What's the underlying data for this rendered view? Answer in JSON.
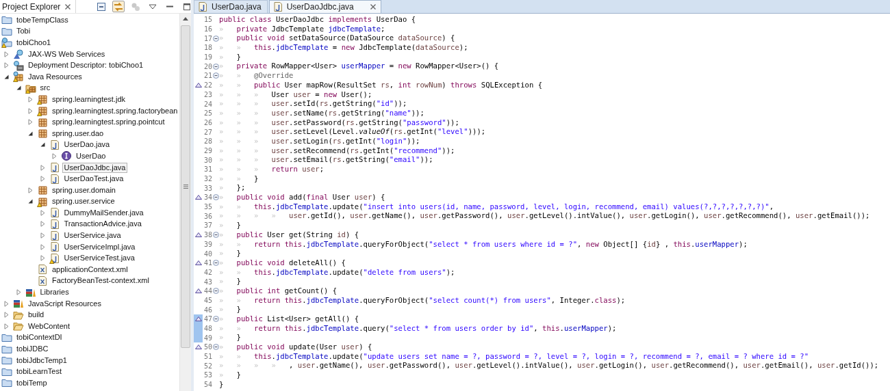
{
  "explorer": {
    "title": "Project Explorer",
    "toolbar": [
      {
        "kind": "collapse-all",
        "pressed": false,
        "disabled": false
      },
      {
        "kind": "link",
        "pressed": true,
        "disabled": false
      },
      {
        "kind": "gears",
        "pressed": false,
        "disabled": true
      },
      {
        "kind": "view-menu",
        "pressed": false,
        "disabled": false
      },
      {
        "kind": "minimize",
        "pressed": false,
        "disabled": false
      },
      {
        "kind": "maximize",
        "pressed": false,
        "disabled": false
      }
    ],
    "tree": [
      {
        "label": "tobeTempClass",
        "kind": "project",
        "warning": false,
        "selected": false
      },
      {
        "label": "Tobi",
        "kind": "project",
        "warning": false,
        "selected": false
      },
      {
        "label": "tobiChoo1",
        "kind": "web-project",
        "warning": true,
        "selected": false,
        "children": [
          {
            "label": "JAX-WS Web Services",
            "kind": "ws",
            "warning": false,
            "selected": false,
            "expanded": false
          },
          {
            "label": "Deployment Descriptor: tobiChoo1",
            "kind": "descriptor",
            "warning": false,
            "selected": false,
            "expanded": false
          },
          {
            "label": "Java Resources",
            "kind": "resources",
            "warning": true,
            "selected": false,
            "expanded": true,
            "children": [
              {
                "label": "src",
                "kind": "src",
                "warning": true,
                "selected": false,
                "expanded": true,
                "children": [
                  {
                    "label": "spring.learningtest.jdk",
                    "kind": "package",
                    "warning": true,
                    "selected": false,
                    "expanded": false
                  },
                  {
                    "label": "spring.learningtest.spring.factorybean",
                    "kind": "package",
                    "warning": true,
                    "selected": false,
                    "expanded": false
                  },
                  {
                    "label": "spring.learningtest.spring.pointcut",
                    "kind": "package",
                    "warning": false,
                    "selected": false,
                    "expanded": false
                  },
                  {
                    "label": "spring.user.dao",
                    "kind": "package",
                    "warning": false,
                    "selected": false,
                    "expanded": true,
                    "children": [
                      {
                        "label": "UserDao.java",
                        "kind": "java",
                        "warning": false,
                        "selected": false,
                        "expanded": true,
                        "children": [
                          {
                            "label": "UserDao",
                            "kind": "interface",
                            "warning": false,
                            "selected": false,
                            "expanded": false
                          }
                        ]
                      },
                      {
                        "label": "UserDaoJdbc.java",
                        "kind": "java",
                        "warning": false,
                        "selected": true,
                        "expanded": false
                      },
                      {
                        "label": "UserDaoTest.java",
                        "kind": "java",
                        "warning": false,
                        "selected": false,
                        "expanded": false
                      }
                    ]
                  },
                  {
                    "label": "spring.user.domain",
                    "kind": "package",
                    "warning": false,
                    "selected": false,
                    "expanded": false
                  },
                  {
                    "label": "spring.user.service",
                    "kind": "package",
                    "warning": true,
                    "selected": false,
                    "expanded": true,
                    "children": [
                      {
                        "label": "DummyMailSender.java",
                        "kind": "java",
                        "warning": false,
                        "selected": false,
                        "expanded": false
                      },
                      {
                        "label": "TransactionAdvice.java",
                        "kind": "java",
                        "warning": false,
                        "selected": false,
                        "expanded": false
                      },
                      {
                        "label": "UserService.java",
                        "kind": "java",
                        "warning": false,
                        "selected": false,
                        "expanded": false
                      },
                      {
                        "label": "UserServiceImpl.java",
                        "kind": "java",
                        "warning": false,
                        "selected": false,
                        "expanded": false
                      },
                      {
                        "label": "UserServiceTest.java",
                        "kind": "java",
                        "warning": true,
                        "selected": false,
                        "expanded": false
                      }
                    ]
                  },
                  {
                    "label": "applicationContext.xml",
                    "kind": "xml",
                    "warning": false,
                    "selected": false
                  },
                  {
                    "label": "FactoryBeanTest-context.xml",
                    "kind": "xml",
                    "warning": false,
                    "selected": false
                  }
                ]
              },
              {
                "label": "Libraries",
                "kind": "library",
                "warning": false,
                "selected": false,
                "expanded": false
              }
            ]
          },
          {
            "label": "JavaScript Resources",
            "kind": "library",
            "warning": false,
            "selected": false,
            "expanded": false
          },
          {
            "label": "build",
            "kind": "folder",
            "warning": false,
            "selected": false,
            "expanded": false
          },
          {
            "label": "WebContent",
            "kind": "folder",
            "warning": false,
            "selected": false,
            "expanded": false
          }
        ]
      },
      {
        "label": "tobiContextDI",
        "kind": "project",
        "warning": false,
        "selected": false
      },
      {
        "label": "tobiJDBC",
        "kind": "project",
        "warning": false,
        "selected": false
      },
      {
        "label": "tobiJdbcTemp1",
        "kind": "project",
        "warning": false,
        "selected": false
      },
      {
        "label": "tobiLearnTest",
        "kind": "project",
        "warning": false,
        "selected": false
      },
      {
        "label": "tobiTemp",
        "kind": "project",
        "warning": false,
        "selected": false
      }
    ]
  },
  "editor": {
    "tabs": [
      {
        "label": "UserDao.java",
        "selected": false
      },
      {
        "label": "UserDaoJdbc.java",
        "selected": true
      }
    ],
    "lines": [
      {
        "num": "15",
        "override": false,
        "fold": false,
        "changed": false,
        "parts": [
          {
            "kind": "keyword",
            "text": "public class"
          },
          {
            "kind": "plain",
            "text": " UserDaoJdbc "
          },
          {
            "kind": "keyword",
            "text": "implements"
          },
          {
            "kind": "plain",
            "text": " UserDao {"
          }
        ]
      },
      {
        "num": "16",
        "override": false,
        "fold": false,
        "changed": false,
        "parts": [
          {
            "kind": "whitespace",
            "text": "»   "
          },
          {
            "kind": "keyword",
            "text": "private"
          },
          {
            "kind": "plain",
            "text": " JdbcTemplate "
          },
          {
            "kind": "field",
            "text": "jdbcTemplate"
          },
          {
            "kind": "plain",
            "text": ";"
          }
        ]
      },
      {
        "num": "17",
        "override": false,
        "fold": true,
        "changed": false,
        "parts": [
          {
            "kind": "whitespace",
            "text": "»   "
          },
          {
            "kind": "keyword",
            "text": "public void"
          },
          {
            "kind": "plain",
            "text": " setDataSource(DataSource "
          },
          {
            "kind": "variable",
            "text": "dataSource"
          },
          {
            "kind": "plain",
            "text": ") {"
          }
        ]
      },
      {
        "num": "18",
        "override": false,
        "fold": false,
        "changed": false,
        "parts": [
          {
            "kind": "whitespace",
            "text": "»   »   "
          },
          {
            "kind": "keyword",
            "text": "this"
          },
          {
            "kind": "plain",
            "text": "."
          },
          {
            "kind": "field",
            "text": "jdbcTemplate"
          },
          {
            "kind": "plain",
            "text": " = "
          },
          {
            "kind": "keyword",
            "text": "new"
          },
          {
            "kind": "plain",
            "text": " JdbcTemplate("
          },
          {
            "kind": "variable",
            "text": "dataSource"
          },
          {
            "kind": "plain",
            "text": ");"
          }
        ]
      },
      {
        "num": "19",
        "override": false,
        "fold": false,
        "changed": false,
        "parts": [
          {
            "kind": "whitespace",
            "text": "»   "
          },
          {
            "kind": "plain",
            "text": "}"
          }
        ]
      },
      {
        "num": "20",
        "override": false,
        "fold": true,
        "changed": false,
        "parts": [
          {
            "kind": "whitespace",
            "text": "»   "
          },
          {
            "kind": "keyword",
            "text": "private"
          },
          {
            "kind": "plain",
            "text": " RowMapper<User> "
          },
          {
            "kind": "field",
            "text": "userMapper"
          },
          {
            "kind": "plain",
            "text": " = "
          },
          {
            "kind": "keyword",
            "text": "new"
          },
          {
            "kind": "plain",
            "text": " RowMapper<User>() {"
          }
        ]
      },
      {
        "num": "21",
        "override": false,
        "fold": true,
        "changed": false,
        "parts": [
          {
            "kind": "whitespace",
            "text": "»   »   "
          },
          {
            "kind": "annotation",
            "text": "@Override"
          }
        ]
      },
      {
        "num": "22",
        "override": true,
        "fold": false,
        "changed": false,
        "parts": [
          {
            "kind": "whitespace",
            "text": "»   »   "
          },
          {
            "kind": "keyword",
            "text": "public"
          },
          {
            "kind": "plain",
            "text": " User mapRow(ResultSet "
          },
          {
            "kind": "variable",
            "text": "rs"
          },
          {
            "kind": "plain",
            "text": ", "
          },
          {
            "kind": "keyword",
            "text": "int "
          },
          {
            "kind": "variable",
            "text": "rowNum"
          },
          {
            "kind": "plain",
            "text": ") "
          },
          {
            "kind": "keyword",
            "text": "throws"
          },
          {
            "kind": "plain",
            "text": " SQLException {"
          }
        ]
      },
      {
        "num": "23",
        "override": false,
        "fold": false,
        "changed": false,
        "parts": [
          {
            "kind": "whitespace",
            "text": "»   »   »   "
          },
          {
            "kind": "plain",
            "text": "User "
          },
          {
            "kind": "variable",
            "text": "user"
          },
          {
            "kind": "plain",
            "text": " = "
          },
          {
            "kind": "keyword",
            "text": "new"
          },
          {
            "kind": "plain",
            "text": " User();"
          }
        ]
      },
      {
        "num": "24",
        "override": false,
        "fold": false,
        "changed": false,
        "parts": [
          {
            "kind": "whitespace",
            "text": "»   »   »   "
          },
          {
            "kind": "variable",
            "text": "user"
          },
          {
            "kind": "plain",
            "text": ".setId("
          },
          {
            "kind": "variable",
            "text": "rs"
          },
          {
            "kind": "plain",
            "text": ".getString("
          },
          {
            "kind": "string",
            "text": "\"id\""
          },
          {
            "kind": "plain",
            "text": "));"
          }
        ]
      },
      {
        "num": "25",
        "override": false,
        "fold": false,
        "changed": false,
        "parts": [
          {
            "kind": "whitespace",
            "text": "»   »   »   "
          },
          {
            "kind": "variable",
            "text": "user"
          },
          {
            "kind": "plain",
            "text": ".setName("
          },
          {
            "kind": "variable",
            "text": "rs"
          },
          {
            "kind": "plain",
            "text": ".getString("
          },
          {
            "kind": "string",
            "text": "\"name\""
          },
          {
            "kind": "plain",
            "text": "));"
          }
        ]
      },
      {
        "num": "26",
        "override": false,
        "fold": false,
        "changed": false,
        "parts": [
          {
            "kind": "whitespace",
            "text": "»   »   »   "
          },
          {
            "kind": "variable",
            "text": "user"
          },
          {
            "kind": "plain",
            "text": ".setPassword("
          },
          {
            "kind": "variable",
            "text": "rs"
          },
          {
            "kind": "plain",
            "text": ".getString("
          },
          {
            "kind": "string",
            "text": "\"password\""
          },
          {
            "kind": "plain",
            "text": "));"
          }
        ]
      },
      {
        "num": "27",
        "override": false,
        "fold": false,
        "changed": false,
        "parts": [
          {
            "kind": "whitespace",
            "text": "»   »   »   "
          },
          {
            "kind": "variable",
            "text": "user"
          },
          {
            "kind": "plain",
            "text": ".setLevel(Level."
          },
          {
            "kind": "italic",
            "text": "valueOf"
          },
          {
            "kind": "plain",
            "text": "("
          },
          {
            "kind": "variable",
            "text": "rs"
          },
          {
            "kind": "plain",
            "text": ".getInt("
          },
          {
            "kind": "string",
            "text": "\"level\""
          },
          {
            "kind": "plain",
            "text": ")));"
          }
        ]
      },
      {
        "num": "28",
        "override": false,
        "fold": false,
        "changed": false,
        "parts": [
          {
            "kind": "whitespace",
            "text": "»   »   »   "
          },
          {
            "kind": "variable",
            "text": "user"
          },
          {
            "kind": "plain",
            "text": ".setLogin("
          },
          {
            "kind": "variable",
            "text": "rs"
          },
          {
            "kind": "plain",
            "text": ".getInt("
          },
          {
            "kind": "string",
            "text": "\"login\""
          },
          {
            "kind": "plain",
            "text": "));"
          }
        ]
      },
      {
        "num": "29",
        "override": false,
        "fold": false,
        "changed": false,
        "parts": [
          {
            "kind": "whitespace",
            "text": "»   »   »   "
          },
          {
            "kind": "variable",
            "text": "user"
          },
          {
            "kind": "plain",
            "text": ".setRecommend("
          },
          {
            "kind": "variable",
            "text": "rs"
          },
          {
            "kind": "plain",
            "text": ".getInt("
          },
          {
            "kind": "string",
            "text": "\"recommend\""
          },
          {
            "kind": "plain",
            "text": "));"
          }
        ]
      },
      {
        "num": "30",
        "override": false,
        "fold": false,
        "changed": false,
        "parts": [
          {
            "kind": "whitespace",
            "text": "»   »   »   "
          },
          {
            "kind": "variable",
            "text": "user"
          },
          {
            "kind": "plain",
            "text": ".setEmail("
          },
          {
            "kind": "variable",
            "text": "rs"
          },
          {
            "kind": "plain",
            "text": ".getString("
          },
          {
            "kind": "string",
            "text": "\"email\""
          },
          {
            "kind": "plain",
            "text": "));"
          }
        ]
      },
      {
        "num": "31",
        "override": false,
        "fold": false,
        "changed": false,
        "parts": [
          {
            "kind": "whitespace",
            "text": "»   »   »   "
          },
          {
            "kind": "keyword",
            "text": "return "
          },
          {
            "kind": "variable",
            "text": "user"
          },
          {
            "kind": "plain",
            "text": ";"
          }
        ]
      },
      {
        "num": "32",
        "override": false,
        "fold": false,
        "changed": false,
        "parts": [
          {
            "kind": "whitespace",
            "text": "»   »   "
          },
          {
            "kind": "plain",
            "text": "}"
          }
        ]
      },
      {
        "num": "33",
        "override": false,
        "fold": false,
        "changed": false,
        "parts": [
          {
            "kind": "whitespace",
            "text": "»   "
          },
          {
            "kind": "plain",
            "text": "};"
          }
        ]
      },
      {
        "num": "34",
        "override": true,
        "fold": true,
        "changed": false,
        "parts": [
          {
            "kind": "whitespace",
            "text": "»   "
          },
          {
            "kind": "keyword",
            "text": "public void"
          },
          {
            "kind": "plain",
            "text": " add("
          },
          {
            "kind": "keyword",
            "text": "final"
          },
          {
            "kind": "plain",
            "text": " User "
          },
          {
            "kind": "variable",
            "text": "user"
          },
          {
            "kind": "plain",
            "text": ") {"
          }
        ]
      },
      {
        "num": "35",
        "override": false,
        "fold": false,
        "changed": false,
        "parts": [
          {
            "kind": "whitespace",
            "text": "»   »   "
          },
          {
            "kind": "keyword",
            "text": "this"
          },
          {
            "kind": "plain",
            "text": "."
          },
          {
            "kind": "field",
            "text": "jdbcTemplate"
          },
          {
            "kind": "plain",
            "text": ".update("
          },
          {
            "kind": "string",
            "text": "\"insert into users(id, name, password, level, login, recommend, email) values(?,?,?,?,?,?,?)\""
          },
          {
            "kind": "plain",
            "text": ","
          }
        ]
      },
      {
        "num": "36",
        "override": false,
        "fold": false,
        "changed": false,
        "parts": [
          {
            "kind": "whitespace",
            "text": "»   »   »   »   "
          },
          {
            "kind": "variable",
            "text": "user"
          },
          {
            "kind": "plain",
            "text": ".getId(), "
          },
          {
            "kind": "variable",
            "text": "user"
          },
          {
            "kind": "plain",
            "text": ".getName(), "
          },
          {
            "kind": "variable",
            "text": "user"
          },
          {
            "kind": "plain",
            "text": ".getPassword(), "
          },
          {
            "kind": "variable",
            "text": "user"
          },
          {
            "kind": "plain",
            "text": ".getLevel().intValue(), "
          },
          {
            "kind": "variable",
            "text": "user"
          },
          {
            "kind": "plain",
            "text": ".getLogin(), "
          },
          {
            "kind": "variable",
            "text": "user"
          },
          {
            "kind": "plain",
            "text": ".getRecommend(), "
          },
          {
            "kind": "variable",
            "text": "user"
          },
          {
            "kind": "plain",
            "text": ".getEmail());"
          }
        ]
      },
      {
        "num": "37",
        "override": false,
        "fold": false,
        "changed": false,
        "parts": [
          {
            "kind": "whitespace",
            "text": "»   "
          },
          {
            "kind": "plain",
            "text": "}"
          }
        ]
      },
      {
        "num": "38",
        "override": true,
        "fold": true,
        "changed": false,
        "parts": [
          {
            "kind": "whitespace",
            "text": "»   "
          },
          {
            "kind": "keyword",
            "text": "public"
          },
          {
            "kind": "plain",
            "text": " User get(String "
          },
          {
            "kind": "variable",
            "text": "id"
          },
          {
            "kind": "plain",
            "text": ") {"
          }
        ]
      },
      {
        "num": "39",
        "override": false,
        "fold": false,
        "changed": false,
        "parts": [
          {
            "kind": "whitespace",
            "text": "»   »   "
          },
          {
            "kind": "keyword",
            "text": "return this"
          },
          {
            "kind": "plain",
            "text": "."
          },
          {
            "kind": "field",
            "text": "jdbcTemplate"
          },
          {
            "kind": "plain",
            "text": ".queryForObject("
          },
          {
            "kind": "string",
            "text": "\"select * from users where id = ?\""
          },
          {
            "kind": "plain",
            "text": ", "
          },
          {
            "kind": "keyword",
            "text": "new"
          },
          {
            "kind": "plain",
            "text": " Object[] {"
          },
          {
            "kind": "variable",
            "text": "id"
          },
          {
            "kind": "plain",
            "text": "} , "
          },
          {
            "kind": "keyword",
            "text": "this"
          },
          {
            "kind": "plain",
            "text": "."
          },
          {
            "kind": "field",
            "text": "userMapper"
          },
          {
            "kind": "plain",
            "text": ");"
          }
        ]
      },
      {
        "num": "40",
        "override": false,
        "fold": false,
        "changed": false,
        "parts": [
          {
            "kind": "whitespace",
            "text": "»   "
          },
          {
            "kind": "plain",
            "text": "}"
          }
        ]
      },
      {
        "num": "41",
        "override": true,
        "fold": true,
        "changed": false,
        "parts": [
          {
            "kind": "whitespace",
            "text": "»   "
          },
          {
            "kind": "keyword",
            "text": "public void"
          },
          {
            "kind": "plain",
            "text": " deleteAll() {"
          }
        ]
      },
      {
        "num": "42",
        "override": false,
        "fold": false,
        "changed": false,
        "parts": [
          {
            "kind": "whitespace",
            "text": "»   »   "
          },
          {
            "kind": "keyword",
            "text": "this"
          },
          {
            "kind": "plain",
            "text": "."
          },
          {
            "kind": "field",
            "text": "jdbcTemplate"
          },
          {
            "kind": "plain",
            "text": ".update("
          },
          {
            "kind": "string",
            "text": "\"delete from users\""
          },
          {
            "kind": "plain",
            "text": ");"
          }
        ]
      },
      {
        "num": "43",
        "override": false,
        "fold": false,
        "changed": false,
        "parts": [
          {
            "kind": "whitespace",
            "text": "»   "
          },
          {
            "kind": "plain",
            "text": "}"
          }
        ]
      },
      {
        "num": "44",
        "override": true,
        "fold": true,
        "changed": false,
        "parts": [
          {
            "kind": "whitespace",
            "text": "»   "
          },
          {
            "kind": "keyword",
            "text": "public int"
          },
          {
            "kind": "plain",
            "text": " getCount() {"
          }
        ]
      },
      {
        "num": "45",
        "override": false,
        "fold": false,
        "changed": false,
        "parts": [
          {
            "kind": "whitespace",
            "text": "»   »   "
          },
          {
            "kind": "keyword",
            "text": "return this"
          },
          {
            "kind": "plain",
            "text": "."
          },
          {
            "kind": "field",
            "text": "jdbcTemplate"
          },
          {
            "kind": "plain",
            "text": ".queryForObject("
          },
          {
            "kind": "string",
            "text": "\"select count(*) from users\""
          },
          {
            "kind": "plain",
            "text": ", Integer."
          },
          {
            "kind": "keyword",
            "text": "class"
          },
          {
            "kind": "plain",
            "text": ");"
          }
        ]
      },
      {
        "num": "46",
        "override": false,
        "fold": false,
        "changed": false,
        "parts": [
          {
            "kind": "whitespace",
            "text": "»   "
          },
          {
            "kind": "plain",
            "text": "}"
          }
        ]
      },
      {
        "num": "47",
        "override": true,
        "fold": true,
        "changed": true,
        "parts": [
          {
            "kind": "whitespace",
            "text": "»   "
          },
          {
            "kind": "keyword",
            "text": "public"
          },
          {
            "kind": "plain",
            "text": " List<User> getAll() {"
          }
        ]
      },
      {
        "num": "48",
        "override": false,
        "fold": false,
        "changed": true,
        "parts": [
          {
            "kind": "whitespace",
            "text": "»   »   "
          },
          {
            "kind": "keyword",
            "text": "return this"
          },
          {
            "kind": "plain",
            "text": "."
          },
          {
            "kind": "field",
            "text": "jdbcTemplate"
          },
          {
            "kind": "plain",
            "text": ".query("
          },
          {
            "kind": "string",
            "text": "\"select * from users order by id\""
          },
          {
            "kind": "plain",
            "text": ", "
          },
          {
            "kind": "keyword",
            "text": "this"
          },
          {
            "kind": "plain",
            "text": "."
          },
          {
            "kind": "field",
            "text": "userMapper"
          },
          {
            "kind": "plain",
            "text": ");"
          }
        ]
      },
      {
        "num": "49",
        "override": false,
        "fold": false,
        "changed": true,
        "parts": [
          {
            "kind": "whitespace",
            "text": "»   "
          },
          {
            "kind": "plain",
            "text": "}"
          }
        ]
      },
      {
        "num": "50",
        "override": true,
        "fold": true,
        "changed": false,
        "parts": [
          {
            "kind": "whitespace",
            "text": "»   "
          },
          {
            "kind": "keyword",
            "text": "public void"
          },
          {
            "kind": "plain",
            "text": " update(User "
          },
          {
            "kind": "variable",
            "text": "user"
          },
          {
            "kind": "plain",
            "text": ") {"
          }
        ]
      },
      {
        "num": "51",
        "override": false,
        "fold": false,
        "changed": false,
        "parts": [
          {
            "kind": "whitespace",
            "text": "»   »   "
          },
          {
            "kind": "keyword",
            "text": "this"
          },
          {
            "kind": "plain",
            "text": "."
          },
          {
            "kind": "field",
            "text": "jdbcTemplate"
          },
          {
            "kind": "plain",
            "text": ".update("
          },
          {
            "kind": "string",
            "text": "\"update users set name = ?, password = ?, level = ?, login = ?, recommend = ?, email = ? where id = ?\""
          }
        ]
      },
      {
        "num": "52",
        "override": false,
        "fold": false,
        "changed": false,
        "parts": [
          {
            "kind": "whitespace",
            "text": "»   »   »   »   "
          },
          {
            "kind": "plain",
            "text": ", "
          },
          {
            "kind": "variable",
            "text": "user"
          },
          {
            "kind": "plain",
            "text": ".getName(), "
          },
          {
            "kind": "variable",
            "text": "user"
          },
          {
            "kind": "plain",
            "text": ".getPassword(), "
          },
          {
            "kind": "variable",
            "text": "user"
          },
          {
            "kind": "plain",
            "text": ".getLevel().intValue(), "
          },
          {
            "kind": "variable",
            "text": "user"
          },
          {
            "kind": "plain",
            "text": ".getLogin(), "
          },
          {
            "kind": "variable",
            "text": "user"
          },
          {
            "kind": "plain",
            "text": ".getRecommend(), "
          },
          {
            "kind": "variable",
            "text": "user"
          },
          {
            "kind": "plain",
            "text": ".getEmail(), "
          },
          {
            "kind": "variable",
            "text": "user"
          },
          {
            "kind": "plain",
            "text": ".getId());"
          }
        ]
      },
      {
        "num": "53",
        "override": false,
        "fold": false,
        "changed": false,
        "parts": [
          {
            "kind": "whitespace",
            "text": "»   "
          },
          {
            "kind": "plain",
            "text": "}"
          }
        ]
      },
      {
        "num": "54",
        "override": false,
        "fold": false,
        "changed": false,
        "parts": [
          {
            "kind": "plain",
            "text": "}"
          }
        ]
      }
    ]
  }
}
